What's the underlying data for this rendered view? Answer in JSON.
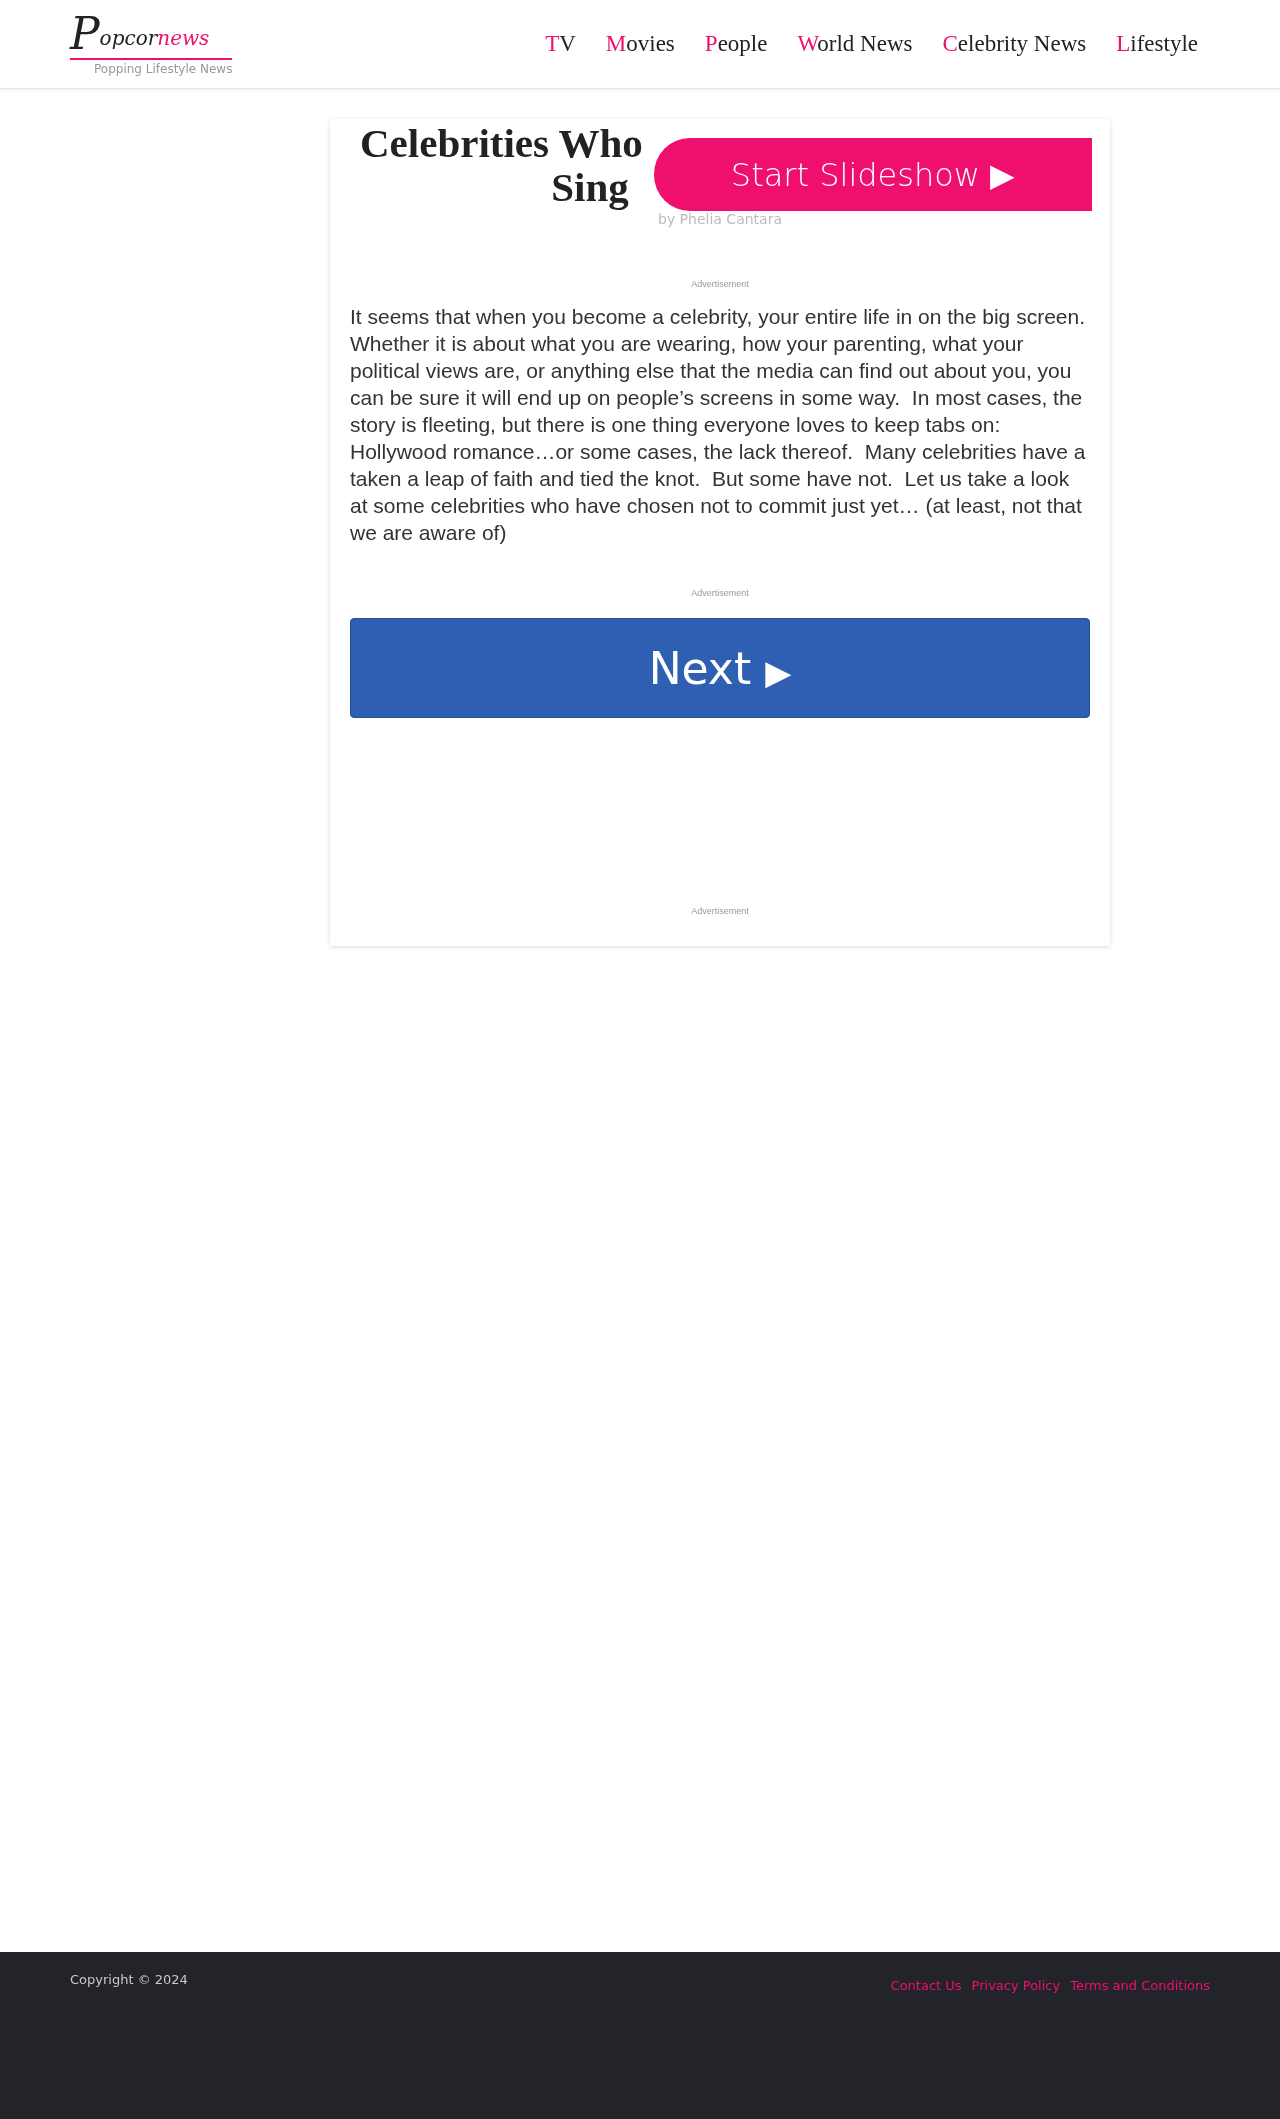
{
  "logo": {
    "initial": "P",
    "name": "opcor",
    "accent": "news",
    "tagline": "Popping Lifestyle News"
  },
  "nav": [
    {
      "label": "TV"
    },
    {
      "label": "Movies"
    },
    {
      "label": "People"
    },
    {
      "label": "World News"
    },
    {
      "label": "Celebrity News"
    },
    {
      "label": "Lifestyle"
    }
  ],
  "article": {
    "title_lines": [
      "Celebrities Who",
      "Sing"
    ],
    "slideshow_button": "Start Slideshow ▶",
    "byline": "by Phelia Cantara",
    "ad_labels": [
      "Advertisement",
      "Advertisement",
      "Advertisement"
    ],
    "body": "It seems that when you become a celebrity, your entire life in on the big screen. Whether it is about what you are wearing, how your parenting, what your political views are, or anything else that the media can find out about you, you can be sure it will end up on people’s screens in some way.  In most cases, the story is fleeting, but there is one thing everyone loves to keep tabs on: Hollywood romance…or some cases, the lack thereof.  Many celebrities have a taken a leap of faith and tied the knot.  But some have not.  Let us take a look at some celebrities who have chosen not to commit just yet… (at least, not that we are aware of)",
    "next_button": {
      "label": "Next",
      "arrow": "▶"
    }
  },
  "footer": {
    "copyright": "Copyright © 2024",
    "links": [
      "Contact Us",
      "Privacy Policy",
      "Terms and Conditions"
    ]
  }
}
